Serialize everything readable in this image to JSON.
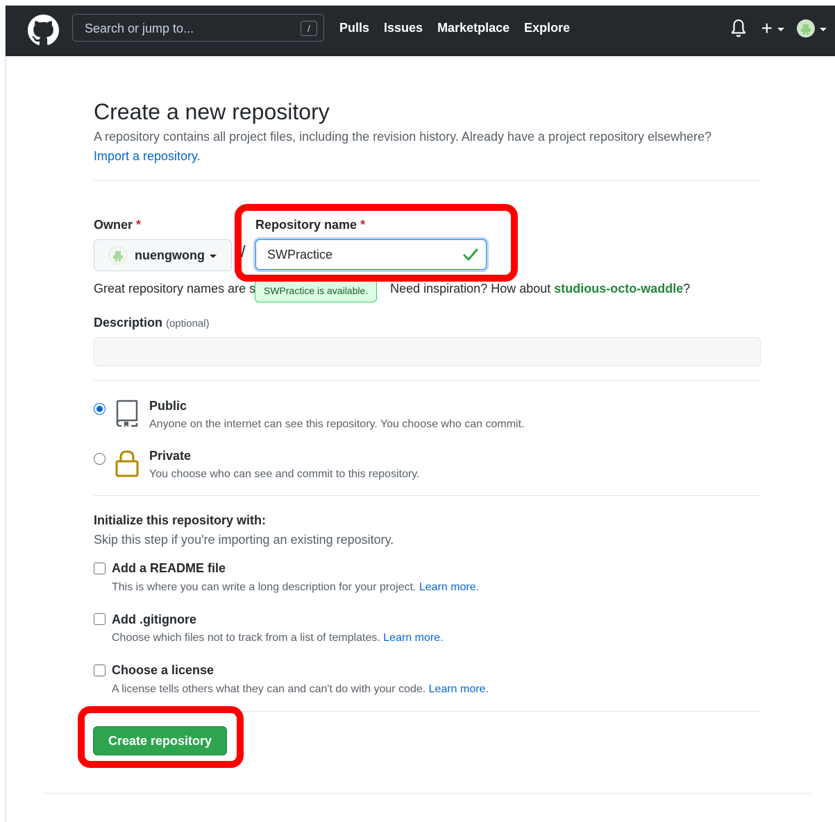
{
  "header": {
    "search_placeholder": "Search or jump to...",
    "search_shortcut": "/",
    "nav": [
      "Pulls",
      "Issues",
      "Marketplace",
      "Explore"
    ],
    "plus_symbol": "+",
    "logo_icon": "github-octocat-icon",
    "bell_icon": "bell-icon"
  },
  "page": {
    "title": "Create a new repository",
    "subtitle": "A repository contains all project files, including the revision history. Already have a project repository elsewhere?",
    "import_link": "Import a repository."
  },
  "owner": {
    "label": "Owner",
    "required_mark": "*",
    "name": "nuengwong"
  },
  "separator": "/",
  "repo": {
    "label": "Repository name",
    "required_mark": "*",
    "value": "SWPractice",
    "availability_tooltip": "SWPractice is available."
  },
  "hint": {
    "prefix": "Great repository names are s",
    "middle": "Need inspiration? How about ",
    "suggestion": "studious-octo-waddle",
    "suffix": "?"
  },
  "description": {
    "label": "Description",
    "optional": "(optional)",
    "value": ""
  },
  "visibility": [
    {
      "title": "Public",
      "desc": "Anyone on the internet can see this repository. You choose who can commit.",
      "selected": true,
      "icon": "repo-icon"
    },
    {
      "title": "Private",
      "desc": "You choose who can see and commit to this repository.",
      "selected": false,
      "icon": "lock-icon"
    }
  ],
  "initialize": {
    "title": "Initialize this repository with:",
    "subtitle": "Skip this step if you're importing an existing repository.",
    "options": [
      {
        "title": "Add a README file",
        "desc": "This is where you can write a long description for your project.",
        "learn": "Learn more."
      },
      {
        "title": "Add .gitignore",
        "desc": "Choose which files not to track from a list of templates.",
        "learn": "Learn more."
      },
      {
        "title": "Choose a license",
        "desc": "A license tells others what they can and can't do with your code.",
        "learn": "Learn more."
      }
    ]
  },
  "create_button": "Create repository",
  "colors": {
    "header_bg": "#24292e",
    "primary_button": "#2ea44f",
    "link": "#0366d6",
    "annotation": "#ff0000",
    "success": "#22863a"
  }
}
